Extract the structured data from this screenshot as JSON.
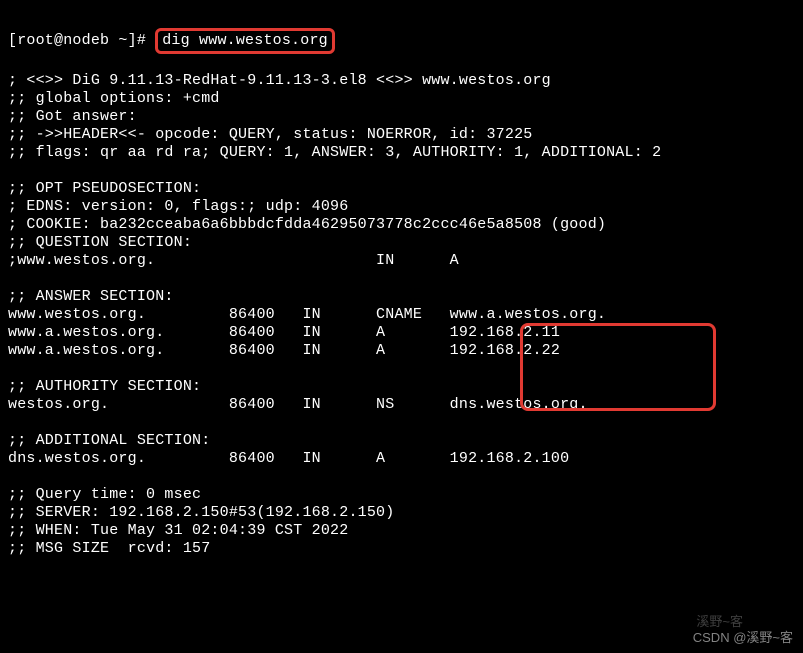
{
  "prompt": {
    "user_host": "[root@nodeb ~]# ",
    "command": "dig www.westos.org"
  },
  "version_line": "; <<>> DiG 9.11.13-RedHat-9.11.13-3.el8 <<>> www.westos.org",
  "global_options": ";; global options: +cmd",
  "got_answer": ";; Got answer:",
  "header_line": ";; ->>HEADER<<- opcode: QUERY, status: NOERROR, id: 37225",
  "flags_line": ";; flags: qr aa rd ra; QUERY: 1, ANSWER: 3, AUTHORITY: 1, ADDITIONAL: 2",
  "opt_section": ";; OPT PSEUDOSECTION:",
  "edns_line": "; EDNS: version: 0, flags:; udp: 4096",
  "cookie_line": "; COOKIE: ba232cceaba6a6bbbdcfdda46295073778c2ccc46e5a8508 (good)",
  "question_header": ";; QUESTION SECTION:",
  "question_row": ";www.westos.org.                        IN      A",
  "answer_header": ";; ANSWER SECTION:",
  "answer_rows": [
    "www.westos.org.         86400   IN      CNAME   www.a.westos.org.",
    "www.a.westos.org.       86400   IN      A       192.168.2.11",
    "www.a.westos.org.       86400   IN      A       192.168.2.22"
  ],
  "authority_header": ";; AUTHORITY SECTION:",
  "authority_row": "westos.org.             86400   IN      NS      dns.westos.org.",
  "additional_header": ";; ADDITIONAL SECTION:",
  "additional_row": "dns.westos.org.         86400   IN      A       192.168.2.100",
  "query_time": ";; Query time: 0 msec",
  "server_line": ";; SERVER: 192.168.2.150#53(192.168.2.150)",
  "when_line": ";; WHEN: Tue May 31 02:04:39 CST 2022",
  "msg_size": ";; MSG SIZE  rcvd: 157",
  "watermark_main": "CSDN @溪野~客",
  "watermark_faint": "溪野~客"
}
